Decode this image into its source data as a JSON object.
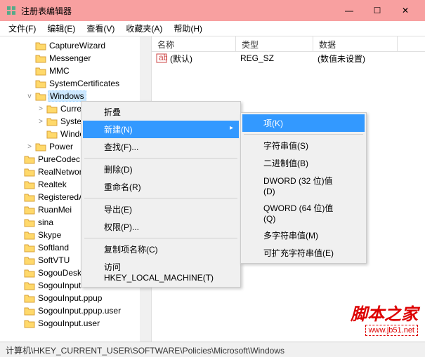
{
  "window": {
    "title": "注册表编辑器",
    "minimize": "—",
    "maximize": "☐",
    "close": "✕"
  },
  "menubar": [
    "文件(F)",
    "编辑(E)",
    "查看(V)",
    "收藏夹(A)",
    "帮助(H)"
  ],
  "tree": {
    "items": [
      {
        "indent": 2,
        "exp": "",
        "label": "CaptureWizard"
      },
      {
        "indent": 2,
        "exp": "",
        "label": "Messenger"
      },
      {
        "indent": 2,
        "exp": "",
        "label": "MMC"
      },
      {
        "indent": 2,
        "exp": "",
        "label": "SystemCertificates"
      },
      {
        "indent": 2,
        "exp": "v",
        "label": "Windows",
        "selected": true
      },
      {
        "indent": 3,
        "exp": ">",
        "label": "Curre"
      },
      {
        "indent": 3,
        "exp": ">",
        "label": "Syster"
      },
      {
        "indent": 3,
        "exp": "",
        "label": "Windows"
      },
      {
        "indent": 2,
        "exp": ">",
        "label": "Power"
      },
      {
        "indent": 1,
        "exp": "",
        "label": "PureCodec"
      },
      {
        "indent": 1,
        "exp": "",
        "label": "RealNetworks"
      },
      {
        "indent": 1,
        "exp": "",
        "label": "Realtek"
      },
      {
        "indent": 1,
        "exp": "",
        "label": "RegisteredAppl"
      },
      {
        "indent": 1,
        "exp": "",
        "label": "RuanMei"
      },
      {
        "indent": 1,
        "exp": "",
        "label": "sina"
      },
      {
        "indent": 1,
        "exp": "",
        "label": "Skype"
      },
      {
        "indent": 1,
        "exp": "",
        "label": "Softland"
      },
      {
        "indent": 1,
        "exp": "",
        "label": "SoftVTU"
      },
      {
        "indent": 1,
        "exp": "",
        "label": "SogouDesktopBar"
      },
      {
        "indent": 1,
        "exp": "",
        "label": "SogouInput"
      },
      {
        "indent": 1,
        "exp": "",
        "label": "SogouInput.ppup"
      },
      {
        "indent": 1,
        "exp": "",
        "label": "SogouInput.ppup.user"
      },
      {
        "indent": 1,
        "exp": "",
        "label": "SogouInput.user"
      }
    ]
  },
  "list": {
    "headers": [
      "名称",
      "类型",
      "数据"
    ],
    "rows": [
      {
        "name": "(默认)",
        "type": "REG_SZ",
        "data": "(数值未设置)"
      }
    ]
  },
  "context_menu": {
    "items": [
      {
        "label": "折叠"
      },
      {
        "label": "新建(N)",
        "submenu": true,
        "highlight": true
      },
      {
        "label": "查找(F)..."
      },
      {
        "sep": true
      },
      {
        "label": "删除(D)"
      },
      {
        "label": "重命名(R)"
      },
      {
        "sep": true
      },
      {
        "label": "导出(E)"
      },
      {
        "label": "权限(P)..."
      },
      {
        "sep": true
      },
      {
        "label": "复制项名称(C)"
      },
      {
        "label": "访问 HKEY_LOCAL_MACHINE(T)"
      }
    ]
  },
  "submenu": {
    "items": [
      {
        "label": "项(K)",
        "highlight": true
      },
      {
        "sep": true
      },
      {
        "label": "字符串值(S)"
      },
      {
        "label": "二进制值(B)"
      },
      {
        "label": "DWORD (32 位)值(D)"
      },
      {
        "label": "QWORD (64 位)值(Q)"
      },
      {
        "label": "多字符串值(M)"
      },
      {
        "label": "可扩充字符串值(E)"
      }
    ]
  },
  "statusbar": "计算机\\HKEY_CURRENT_USER\\SOFTWARE\\Policies\\Microsoft\\Windows",
  "watermark": {
    "cn": "脚本之家",
    "url": "www.jb51.net"
  }
}
